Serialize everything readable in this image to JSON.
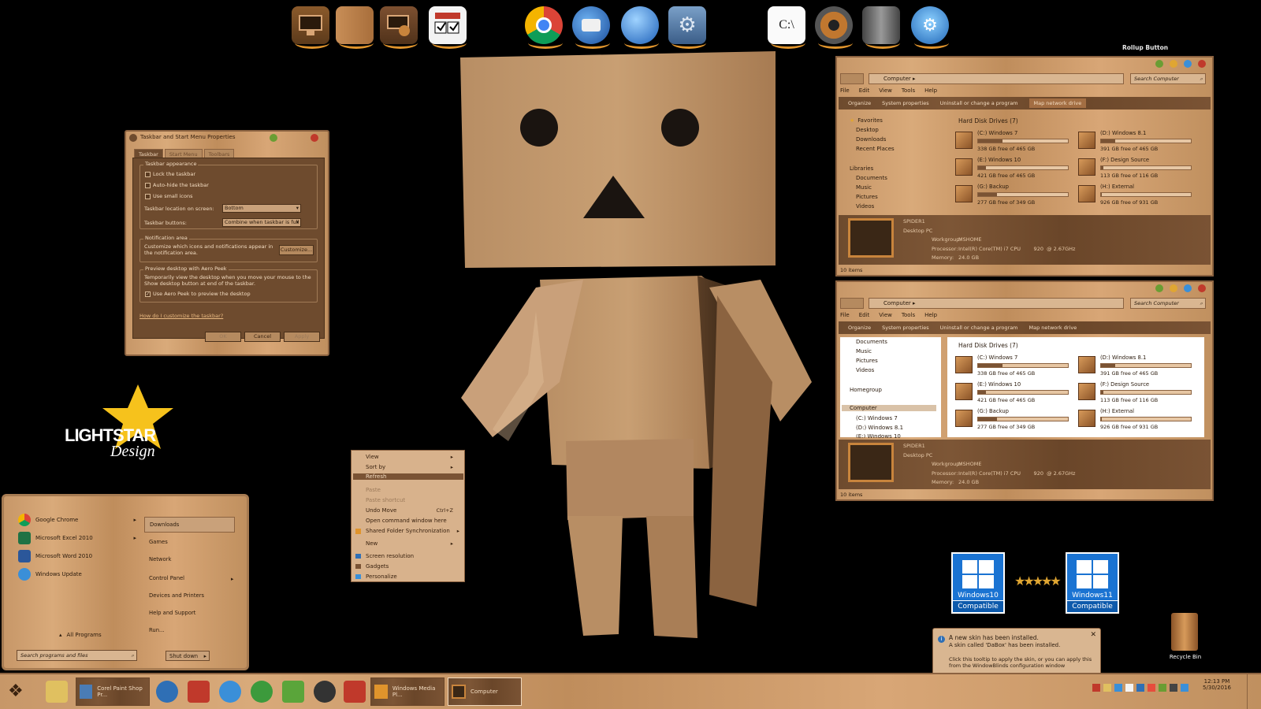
{
  "dock": {
    "icons": [
      "computer-icon",
      "document-box-icon",
      "network-globe-icon",
      "checklist-icon",
      "chrome-icon",
      "thunderbird-icon",
      "google-earth-icon",
      "control-panel-icon",
      "command-prompt-icon",
      "media-disc-icon",
      "server-tower-icon",
      "network-settings-icon"
    ],
    "cmd_label": "C:\\"
  },
  "rollup_label": "Rollup Button",
  "taskbar_props": {
    "title": "Taskbar and Start Menu Properties",
    "tabs": [
      "Taskbar",
      "Start Menu",
      "Toolbars"
    ],
    "appearance_label": "Taskbar appearance",
    "lock": "Lock the taskbar",
    "autohide": "Auto-hide the taskbar",
    "small_icons": "Use small icons",
    "location_label": "Taskbar location on screen:",
    "location_value": "Bottom",
    "buttons_label": "Taskbar buttons:",
    "buttons_value": "Combine when taskbar is full",
    "notif_label": "Notification area",
    "notif_text": "Customize which icons and notifications appear in the notification area.",
    "customize": "Customize...",
    "peek_label": "Preview desktop with Aero Peek",
    "peek_text": "Temporarily view the desktop when you move your mouse to the Show desktop button at end of the taskbar.",
    "peek_check": "Use Aero Peek to preview the desktop",
    "help_link": "How do I customize the taskbar?",
    "ok": "OK",
    "cancel": "Cancel",
    "apply": "Apply"
  },
  "logo": {
    "line1": "LIGHTSTAR",
    "line2": "Design"
  },
  "start_menu": {
    "programs": [
      {
        "label": "Google Chrome",
        "icon": "chrome-icon",
        "color": "#e94235"
      },
      {
        "label": "Microsoft Excel 2010",
        "icon": "excel-icon",
        "color": "#1f7244"
      },
      {
        "label": "Microsoft Word 2010",
        "icon": "word-icon",
        "color": "#2b579a"
      },
      {
        "label": "Windows Update",
        "icon": "windows-update-icon",
        "color": "#3a8fd8"
      }
    ],
    "all_programs": "All Programs",
    "search_placeholder": "Search programs and files",
    "right_items": [
      "Downloads",
      "Games",
      "Network",
      "Control Panel",
      "Devices and Printers",
      "Help and Support",
      "Run..."
    ],
    "shutdown": "Shut down"
  },
  "context_menu": {
    "items": [
      {
        "label": "View"
      },
      {
        "label": "Sort by"
      },
      {
        "label": "Refresh"
      },
      {
        "label": "Paste"
      },
      {
        "label": "Paste shortcut"
      },
      {
        "label": "Undo Move",
        "shortcut": "Ctrl+Z"
      },
      {
        "label": "Open command window here"
      },
      {
        "label": "Shared Folder Synchronization"
      },
      {
        "label": "New"
      },
      {
        "label": "Screen resolution"
      },
      {
        "label": "Gadgets"
      },
      {
        "label": "Personalize"
      }
    ]
  },
  "explorer1": {
    "address": "Computer",
    "search": "Search Computer",
    "menu": [
      "File",
      "Edit",
      "View",
      "Tools",
      "Help"
    ],
    "commands": [
      "Organize",
      "System properties",
      "Uninstall or change a program",
      "Map network drive"
    ],
    "nav": [
      "Favorites",
      "Desktop",
      "Downloads",
      "Recent Places",
      "Libraries",
      "Documents",
      "Music",
      "Pictures",
      "Videos"
    ],
    "group_title": "Hard Disk Drives (7)",
    "status": "10 items"
  },
  "explorer2": {
    "address": "Computer",
    "search": "Search Computer",
    "menu": [
      "File",
      "Edit",
      "View",
      "Tools",
      "Help"
    ],
    "commands": [
      "Organize",
      "System properties",
      "Uninstall or change a program",
      "Map network drive"
    ],
    "nav": [
      "Documents",
      "Music",
      "Pictures",
      "Videos",
      "Homegroup",
      "Computer",
      "(C:) Windows 7",
      "(D:) Windows 8.1",
      "(E:) Windows 10"
    ],
    "group_title": "Hard Disk Drives (7)",
    "status": "10 items"
  },
  "drives": [
    {
      "name": "(C:) Windows 7",
      "free": "338 GB free of 465 GB",
      "used": 0.27
    },
    {
      "name": "(D:) Windows 8.1",
      "free": "391 GB free of 465 GB",
      "used": 0.16
    },
    {
      "name": "(E:) Windows 10",
      "free": "421 GB free of 465 GB",
      "used": 0.09
    },
    {
      "name": "(F:) Design Source",
      "free": "113 GB free of 116 GB",
      "used": 0.03
    },
    {
      "name": "(G:) Backup",
      "free": "277 GB free of 349 GB",
      "used": 0.21
    },
    {
      "name": "(H:) External",
      "free": "926 GB free of 931 GB",
      "used": 0.01
    }
  ],
  "pc_details": {
    "name": "SPIDER1",
    "type": "Desktop PC",
    "workgroup_label": "Workgroup:",
    "workgroup": "MSHOME",
    "processor_label": "Processor:",
    "processor": "Intel(R) Core(TM) i7 CPU        920  @ 2.67GHz",
    "memory_label": "Memory:",
    "memory": "24.0 GB"
  },
  "badges": [
    {
      "title": "Windows10",
      "sub": "Compatible"
    },
    {
      "title": "Windows11",
      "sub": "Compatible"
    }
  ],
  "recycle_bin": "Recycle Bin",
  "notification": {
    "title": "A new skin has been installed.",
    "line1": "A skin called 'DaBox' has been installed.",
    "line2": "Click this tooltip to apply the skin, or you can apply this from the WindowBlinds configuration window"
  },
  "taskbar": {
    "tasks": [
      "Corel Paint Shop Pr...",
      "Windows Media Pl...",
      "Computer"
    ],
    "time": "12:13 PM",
    "date": "5/30/2016"
  }
}
